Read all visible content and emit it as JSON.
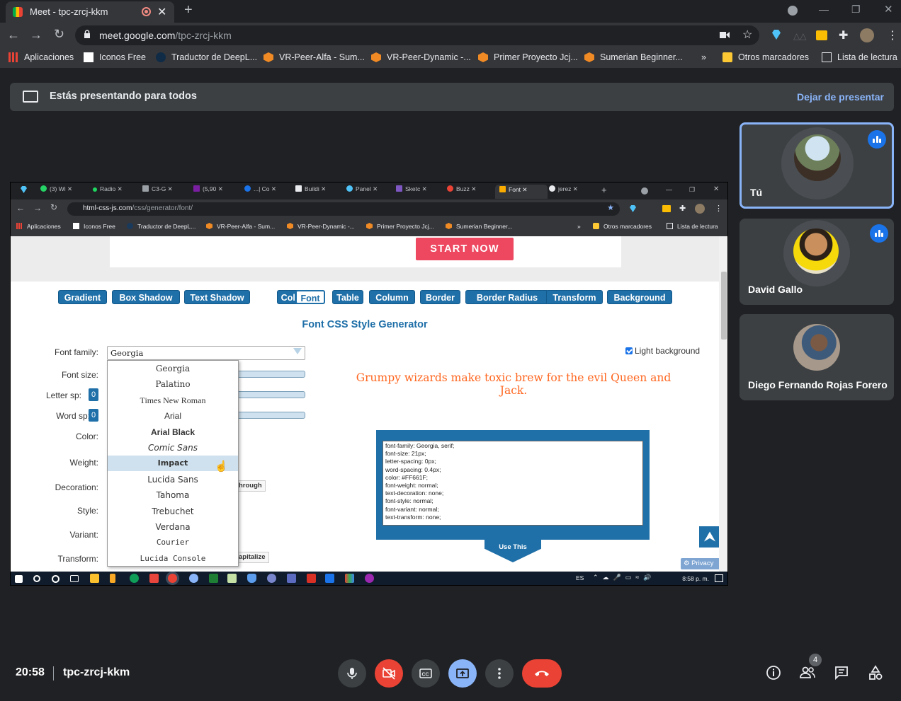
{
  "browser": {
    "tab_title": "Meet - tpc-zrcj-kkm",
    "url_host": "meet.google.com",
    "url_path": "/tpc-zrcj-kkm",
    "bookmarks": [
      "Aplicaciones",
      "Iconos Free",
      "Traductor de DeepL...",
      "VR-Peer-Alfa - Sum...",
      "VR-Peer-Dynamic -...",
      "Primer Proyecto Jcj...",
      "Sumerian Beginner..."
    ],
    "more": "»",
    "other_bookmarks": "Otros marcadores",
    "reading_list": "Lista de lectura"
  },
  "meet": {
    "presenting_text": "Estás presentando para todos",
    "stop_presenting": "Dejar de presentar",
    "time": "20:58",
    "meeting_code": "tpc-zrcj-kkm",
    "participants_badge": "4",
    "participants": [
      {
        "name": "Tú",
        "speaking": true
      },
      {
        "name": "David Gallo",
        "speaking": true
      },
      {
        "name": "Diego Fernando Rojas Forero",
        "speaking": false
      }
    ],
    "colors": {
      "end_call": "#ea4335",
      "camera_off": "#ea4335",
      "present_active": "#8ab4f8",
      "accent": "#8ab4f8"
    }
  },
  "shared": {
    "tabs": [
      "(3) Wi",
      "Radio",
      "C3-G",
      "(5,90",
      "...| Co",
      "Buildi",
      "Panel",
      "Sketc",
      "Buzz",
      "Font",
      "jerez"
    ],
    "url_host": "html-css-js.com",
    "url_path": "/css/generator/font/",
    "bookmarks": [
      "Aplicaciones",
      "Iconos Free",
      "Traductor de DeepL...",
      "VR-Peer-Alfa - Sum...",
      "VR-Peer-Dynamic -...",
      "Primer Proyecto Jcj...",
      "Sumerian Beginner..."
    ],
    "bm_more": "»",
    "bm_other": "Otros marcadores",
    "bm_reading": "Lista de lectura",
    "start_now": "START NOW",
    "gen_tabs": [
      "Gradient",
      "Box Shadow",
      "Text Shadow",
      "Color",
      "Font",
      "Table",
      "Column",
      "Border",
      "Border Radius",
      "Transform",
      "Background"
    ],
    "selected_tab": "Font",
    "title": "Font CSS Style Generator",
    "labels": {
      "family": "Font family:",
      "size": "Font size:",
      "letter": "Letter sp:",
      "word": "Word sp:",
      "color": "Color:",
      "weight": "Weight:",
      "decoration": "Decoration:",
      "style": "Style:",
      "variant": "Variant:",
      "transform": "Transform:"
    },
    "letter_value": "0",
    "word_value": "0",
    "family_value": "Georgia",
    "font_options": [
      "Georgia",
      "Palatino",
      "Times New Roman",
      "Arial",
      "Arial Black",
      "Comic Sans",
      "Impact",
      "Lucida Sans",
      "Tahoma",
      "Trebuchet",
      "Verdana",
      "Courier",
      "Lucida Console"
    ],
    "highlighted_option": "Impact",
    "light_background": "Light background",
    "preview": "Grumpy wizards make toxic brew for the evil Queen and Jack.",
    "css_output": "font-family: Georgia, serif;\nfont-size: 21px;\nletter-spacing: 0px;\nword-spacing: 0.4px;\ncolor: #FF661F;\nfont-weight: normal;\ntext-decoration: none;\nfont-style: normal;\nfont-variant: normal;\ntext-transform: none;",
    "use_this": "Use This",
    "decoration_pill": "hrough",
    "transform_pill": "apitalize",
    "privacy": "Privacy",
    "taskbar_lang": "ES",
    "taskbar_time": "8:58 p. m.",
    "preview_color": "#FF661F",
    "accent": "#1f6fa8"
  }
}
